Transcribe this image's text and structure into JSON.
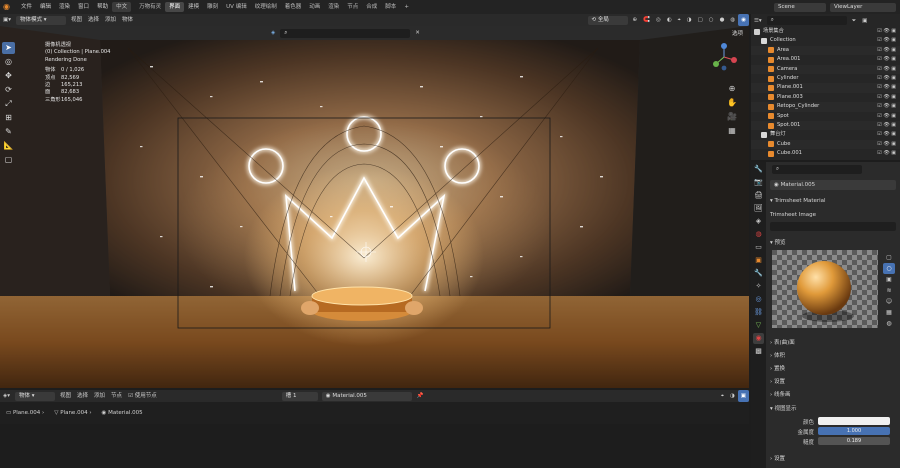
{
  "menu": {
    "items": [
      "文件",
      "编辑",
      "渲染",
      "窗口",
      "帮助"
    ],
    "language_button": "中文",
    "workspaces": [
      "万物有灵",
      "界面",
      "建模",
      "雕刻",
      "UV 编辑",
      "纹理绘制",
      "着色器",
      "动画",
      "渲染",
      "节点",
      "合成",
      "脚本"
    ],
    "active_workspace": "界面",
    "scene_label": "Scene",
    "viewlayer_label": "ViewLayer"
  },
  "viewport_header": {
    "mode": "物体模式",
    "menus": [
      "视图",
      "选择",
      "添加",
      "物体"
    ],
    "transform_orientation": "全局",
    "options": "选项"
  },
  "camera_overlay": {
    "title": "摄像机透视",
    "subtitle": "(0) Collection | Plane.004",
    "status": "Rendering Done",
    "stats": [
      {
        "label": "物体",
        "value": "0 / 1,026"
      },
      {
        "label": "顶点",
        "value": "82,569"
      },
      {
        "label": "边",
        "value": "165,213"
      },
      {
        "label": "面",
        "value": "82,683"
      },
      {
        "label": "三角形",
        "value": "165,046"
      }
    ]
  },
  "node_header": {
    "object_mode": "物体",
    "menus": [
      "视图",
      "选择",
      "添加",
      "节点"
    ],
    "use_nodes_label": "使用节点",
    "slot": "槽 1",
    "material": "Material.005"
  },
  "breadcrumb": [
    "Plane.004",
    "Plane.004",
    "Material.005"
  ],
  "outliner": {
    "title": "场景集合",
    "rows": [
      {
        "label": "Collection",
        "indent": 1,
        "kind": "collection"
      },
      {
        "label": "Area",
        "indent": 2,
        "kind": "light"
      },
      {
        "label": "Area.001",
        "indent": 2,
        "kind": "light"
      },
      {
        "label": "Camera",
        "indent": 2,
        "kind": "camera"
      },
      {
        "label": "Cylinder",
        "indent": 2,
        "kind": "mesh"
      },
      {
        "label": "Plane.001",
        "indent": 2,
        "kind": "mesh"
      },
      {
        "label": "Plane.003",
        "indent": 2,
        "kind": "mesh"
      },
      {
        "label": "Retopo_Cylinder",
        "indent": 2,
        "kind": "mesh"
      },
      {
        "label": "Spot",
        "indent": 2,
        "kind": "light"
      },
      {
        "label": "Spot.001",
        "indent": 2,
        "kind": "light"
      },
      {
        "label": "舞台灯",
        "indent": 1,
        "kind": "collection"
      },
      {
        "label": "Cube",
        "indent": 2,
        "kind": "mesh"
      },
      {
        "label": "Cube.001",
        "indent": 2,
        "kind": "mesh"
      }
    ]
  },
  "properties": {
    "material_name": "Material.005",
    "trimsheet_panel": "Trimsheet Material",
    "trimsheet_image": "Trimsheet Image",
    "preview_panel": "预览",
    "panels": [
      "表(曲)面",
      "体积",
      "置换",
      "设置",
      "线条画"
    ],
    "viewport_display": "视图显示",
    "color_label": "颜色",
    "metallic_label": "金属度",
    "metallic_value": "1.000",
    "roughness_label": "糙度",
    "roughness_value": "0.189",
    "settings_label": "设置"
  },
  "colors": {
    "accent": "#4772b3",
    "orange": "#e88a2e",
    "stage_glow": "#f3c58a"
  }
}
